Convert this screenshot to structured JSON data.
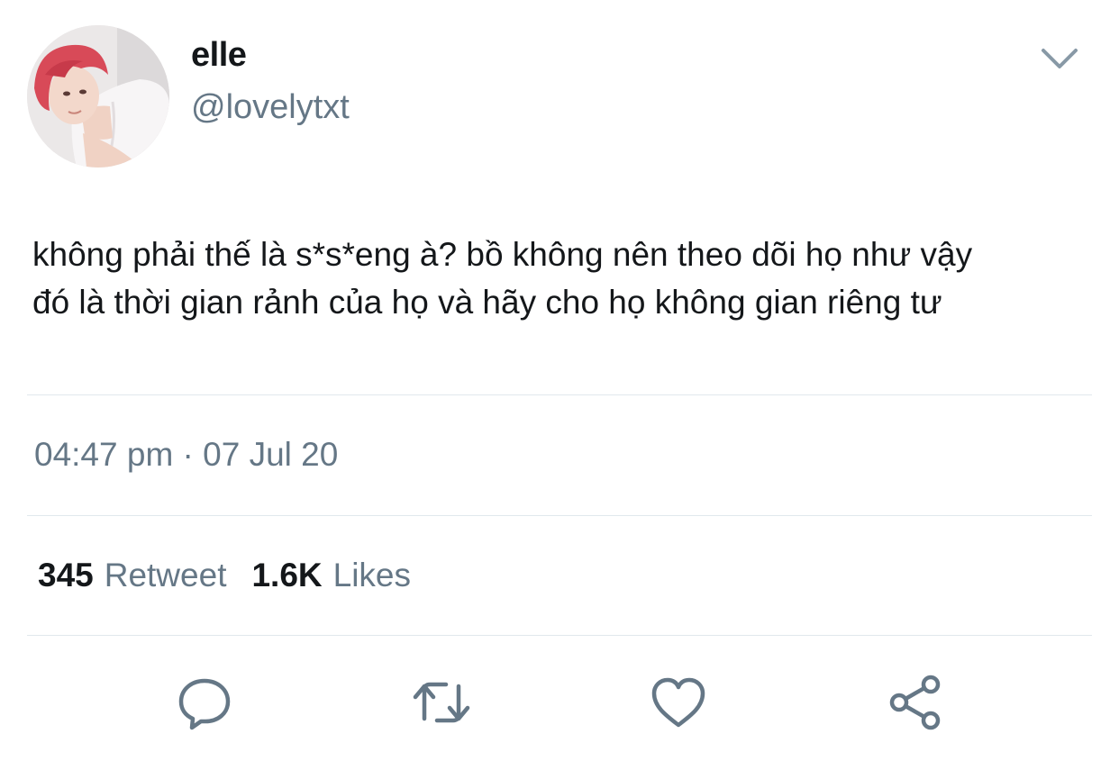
{
  "user": {
    "display_name": "elle",
    "handle": "@lovelytxt",
    "avatar_icon": "profile-photo"
  },
  "menu": {
    "icon": "chevron-down-icon"
  },
  "tweet": {
    "text": "không phải thế là s*s*eng à? bồ không nên theo dõi họ như vậy\nđó là thời gian rảnh của họ và hãy cho họ không gian riêng tư",
    "timestamp": "04:47 pm · 07 Jul 20"
  },
  "stats": {
    "retweets_count": "345",
    "retweets_label": "Retweet",
    "likes_count": "1.6K",
    "likes_label": "Likes"
  },
  "actions": [
    {
      "name": "reply",
      "icon": "comment-icon"
    },
    {
      "name": "retweet",
      "icon": "retweet-icon"
    },
    {
      "name": "like",
      "icon": "heart-icon"
    },
    {
      "name": "share",
      "icon": "share-icon"
    }
  ],
  "colors": {
    "text_primary": "#14171a",
    "text_secondary": "#657786",
    "divider": "#e1e8ed",
    "icon": "#657786",
    "hair": "#d94a5a"
  }
}
